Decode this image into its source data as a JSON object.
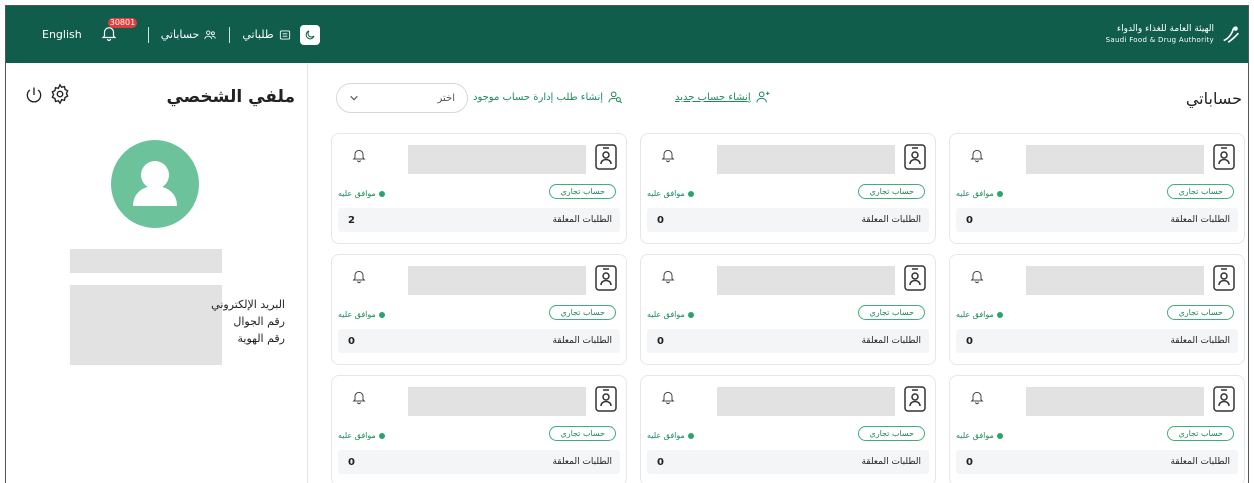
{
  "header": {
    "brand_ar": "الهيئة العامة للغذاء والدواء",
    "brand_en": "Saudi Food & Drug Authority",
    "language": "English",
    "notifications_count": "30801",
    "nav_accounts": "حساباتي",
    "nav_requests": "طلباتي"
  },
  "profile": {
    "title": "ملفي الشخصي",
    "labels": [
      "البريد الإلكتروني",
      "رقم الجوال",
      "رقم الهوية"
    ]
  },
  "main": {
    "title": "حساباتي",
    "new_account": "إنشاء حساب جديد",
    "manage_request": "إنشاء طلب إدارة حساب موجود",
    "select_placeholder": "اختر",
    "cards": [
      {
        "type": "حساب تجاري",
        "status": "موافق عليه",
        "pending_label": "الطلبات المعلقة",
        "pending_count": "0"
      },
      {
        "type": "حساب تجاري",
        "status": "موافق عليه",
        "pending_label": "الطلبات المعلقة",
        "pending_count": "0"
      },
      {
        "type": "حساب تجاري",
        "status": "موافق عليه",
        "pending_label": "الطلبات المعلقة",
        "pending_count": "2"
      },
      {
        "type": "حساب تجاري",
        "status": "موافق عليه",
        "pending_label": "الطلبات المعلقة",
        "pending_count": "0"
      },
      {
        "type": "حساب تجاري",
        "status": "موافق عليه",
        "pending_label": "الطلبات المعلقة",
        "pending_count": "0"
      },
      {
        "type": "حساب تجاري",
        "status": "موافق عليه",
        "pending_label": "الطلبات المعلقة",
        "pending_count": "0"
      },
      {
        "type": "حساب تجاري",
        "status": "موافق عليه",
        "pending_label": "الطلبات المعلقة",
        "pending_count": "0"
      },
      {
        "type": "حساب تجاري",
        "status": "موافق عليه",
        "pending_label": "الطلبات المعلقة",
        "pending_count": "0"
      },
      {
        "type": "حساب تجاري",
        "status": "موافق عليه",
        "pending_label": "الطلبات المعلقة",
        "pending_count": "0"
      }
    ]
  },
  "colors": {
    "header_bg": "#0f5d4a",
    "accent": "#1b8a5a",
    "avatar_bg": "#6cc29b"
  }
}
